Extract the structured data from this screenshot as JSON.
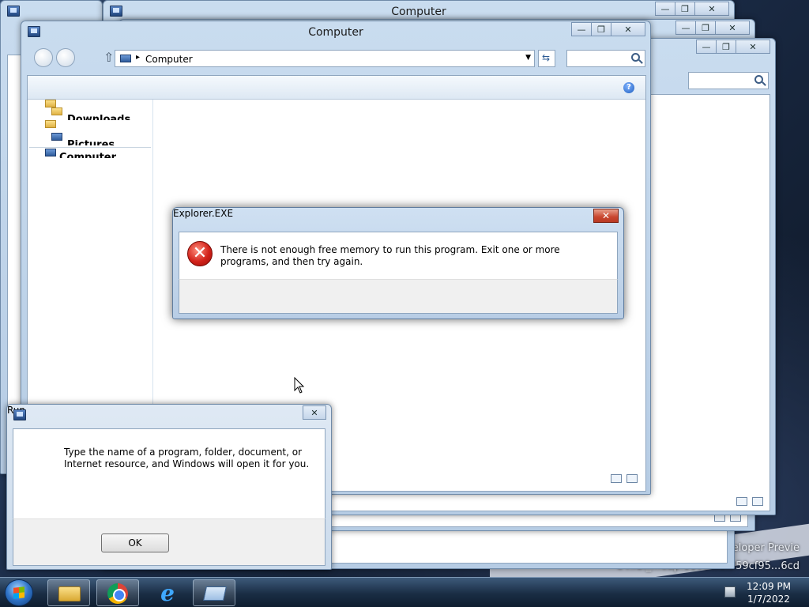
{
  "desktop": {
    "watermark_line1": "eveloper Previe",
    "watermark_line2": "64.fbl_...eap.1108...0.959cf95...6cd"
  },
  "windows": {
    "back_title": "Computer",
    "main_title": "Computer",
    "address_text": "Computer",
    "nav_items": [
      "Downloads",
      "Pictures",
      "Computer"
    ]
  },
  "dialog": {
    "title": "Explorer.EXE",
    "message": "There is not enough free memory to run this program. Exit one or more programs, and then try again.",
    "close_symbol": "✕"
  },
  "run": {
    "title": "Run",
    "message": "Type the name of a program, folder, document, or Internet resource, and Windows will open it for you.",
    "ok_label": "OK",
    "close_symbol": "✕"
  },
  "window_controls": {
    "minimize": "—",
    "maximize": "❐",
    "close": "✕"
  },
  "taskbar": {
    "time": "12:09 PM",
    "date": "1/7/2022",
    "pinned": [
      "file-explorer-icon",
      "chrome-icon",
      "internet-explorer-icon",
      "run-icon"
    ]
  }
}
